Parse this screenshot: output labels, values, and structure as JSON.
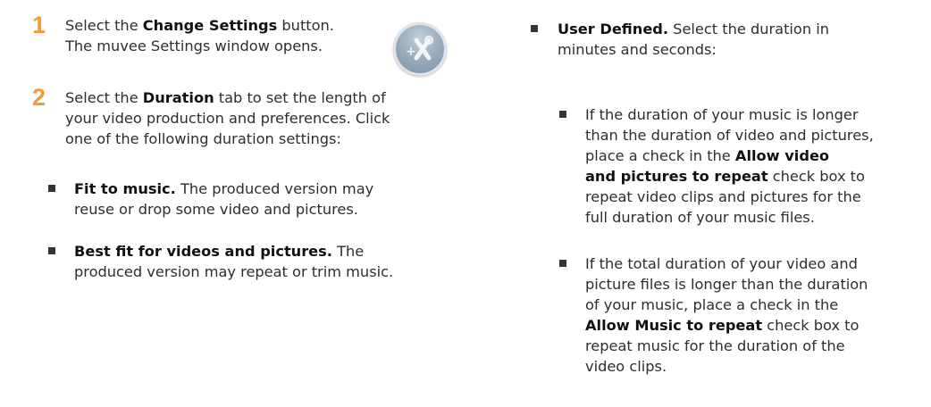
{
  "step1": {
    "number": "1",
    "line1_prefix": "Select the ",
    "line1_bold": "Change Settings",
    "line1_suffix": " button.",
    "line2": "The muvee Settings window opens."
  },
  "step2": {
    "number": "2",
    "line1_prefix": "Select the ",
    "line1_bold": "Duration",
    "line1_suffix": " tab to set the length of",
    "line2": "your video production and preferences. Click",
    "line3": "one of the following duration settings:"
  },
  "bullet_fit": {
    "bold": "Fit to music.",
    "line1_rest": " The produced version may",
    "line2": "reuse or drop some video and pictures."
  },
  "bullet_best": {
    "bold": "Best fit for videos and pictures.",
    "line1_rest": " The",
    "line2": "produced version may repeat or trim music."
  },
  "bullet_user": {
    "bold": "User Defined.",
    "line1_rest": " Select the duration in",
    "line2": "minutes and seconds:"
  },
  "sub_repeat_video": {
    "line1": "If the duration of your music is longer",
    "line2": "than the duration of video and pictures,",
    "line3": "place a check in the ",
    "line3_bold": "Allow video",
    "line4_bold": "and pictures to repeat",
    "line4_rest": " check box to",
    "line5": "repeat video clips and pictures for the",
    "line6": "full duration of your music files."
  },
  "sub_repeat_music": {
    "line1": "If the total duration of your video and",
    "line2": "picture files is longer than the duration",
    "line3": "of your music, place a check in the",
    "line4_bold": "Allow Music to repeat",
    "line4_rest": " check box to",
    "line5": "repeat music for the duration of the",
    "line6": "video clips."
  },
  "icon": "change-settings-icon"
}
